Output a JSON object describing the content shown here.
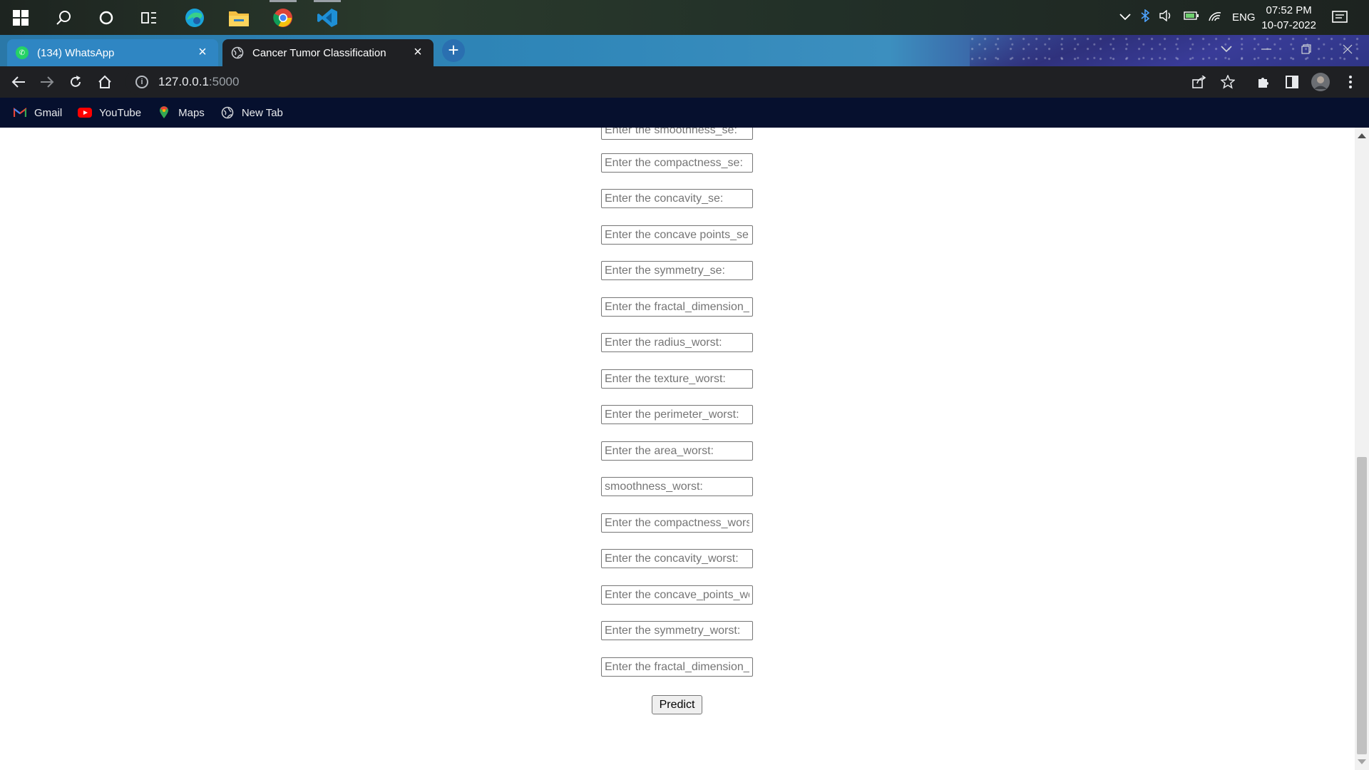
{
  "taskbar": {
    "tray": {
      "language": "ENG"
    },
    "clock": {
      "time": "07:52 PM",
      "date": "10-07-2022"
    }
  },
  "tabs": [
    {
      "title": "(134) WhatsApp",
      "favicon": "whatsapp-icon",
      "active": false
    },
    {
      "title": "Cancer Tumor Classification",
      "favicon": "globe-icon",
      "active": true
    }
  ],
  "address_bar": {
    "url_host": "127.0.0.1",
    "url_port": ":5000"
  },
  "bookmarks": [
    {
      "label": "Gmail",
      "icon": "gmail-icon"
    },
    {
      "label": "YouTube",
      "icon": "youtube-icon"
    },
    {
      "label": "Maps",
      "icon": "maps-icon"
    },
    {
      "label": "New Tab",
      "icon": "globe-icon"
    }
  ],
  "form": {
    "fields": [
      {
        "placeholder": "Enter the smoothness_se:"
      },
      {
        "placeholder": "Enter the compactness_se:"
      },
      {
        "placeholder": "Enter the concavity_se:"
      },
      {
        "placeholder": "Enter the concave points_se:"
      },
      {
        "placeholder": "Enter the symmetry_se:"
      },
      {
        "placeholder": "Enter the fractal_dimension_se:"
      },
      {
        "placeholder": "Enter the radius_worst:"
      },
      {
        "placeholder": "Enter the texture_worst:"
      },
      {
        "placeholder": "Enter the perimeter_worst:"
      },
      {
        "placeholder": "Enter the area_worst:"
      },
      {
        "placeholder": "smoothness_worst:"
      },
      {
        "placeholder": "Enter the compactness_worst:"
      },
      {
        "placeholder": "Enter the concavity_worst:"
      },
      {
        "placeholder": "Enter the concave_points_worst:"
      },
      {
        "placeholder": "Enter the symmetry_worst:"
      },
      {
        "placeholder": "Enter the fractal_dimension_worst:"
      }
    ],
    "submit_label": "Predict"
  },
  "colors": {
    "tab_active_bg": "#1f2023",
    "bookmarks_bg": "#06102e",
    "page_bg": "#ffffff"
  }
}
